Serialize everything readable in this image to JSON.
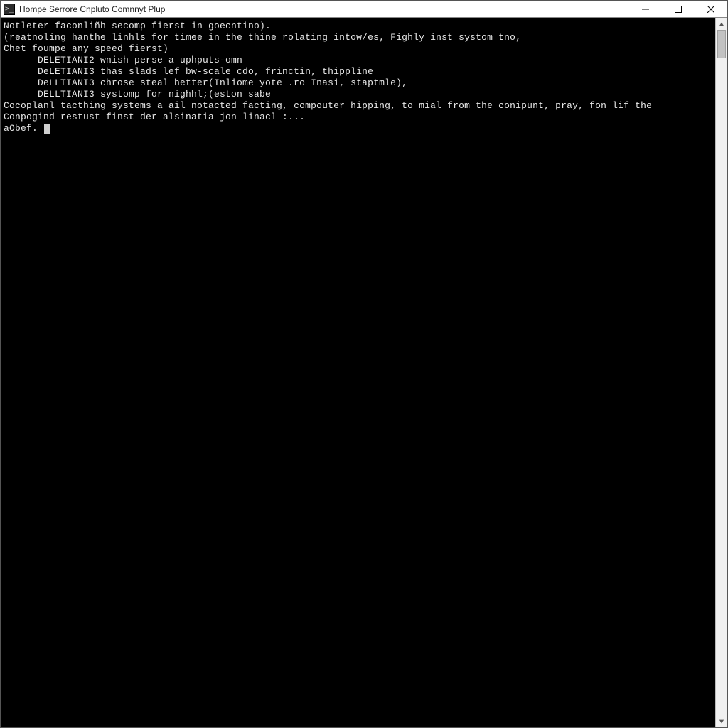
{
  "window": {
    "title": "Hompe Serrore Cnpluto Comnnyt Plup",
    "icon_glyph": ">_"
  },
  "terminal": {
    "lines": [
      "Notleter faconliñh secomp fierst in goecntino).",
      "",
      "(reatnoling hanthe linhls for timee in the thine rolating intow/es, Fighly inst systom tno,",
      "",
      "Chet foumpe any speed fierst)",
      "      DELETIANI2 wnish perse a uphputs-omn",
      "      DeLETIANI3 thas slads lef bw-scale cdo, frinctin, thippline",
      "      DeLLTIANI3 chrose steal hetter(Inliome yote .ro Inasi, staptmle),",
      "      DELLTIANI3 systomp for nighhl;(eston sabe",
      "",
      "Cocoplanl tacthing systems a ail notacted facting, compouter hipping, to mial from the conipunt, pray, fon lif the",
      "Conpogind restust finst der alsinatia jon linacl :...",
      "aObef. "
    ]
  }
}
